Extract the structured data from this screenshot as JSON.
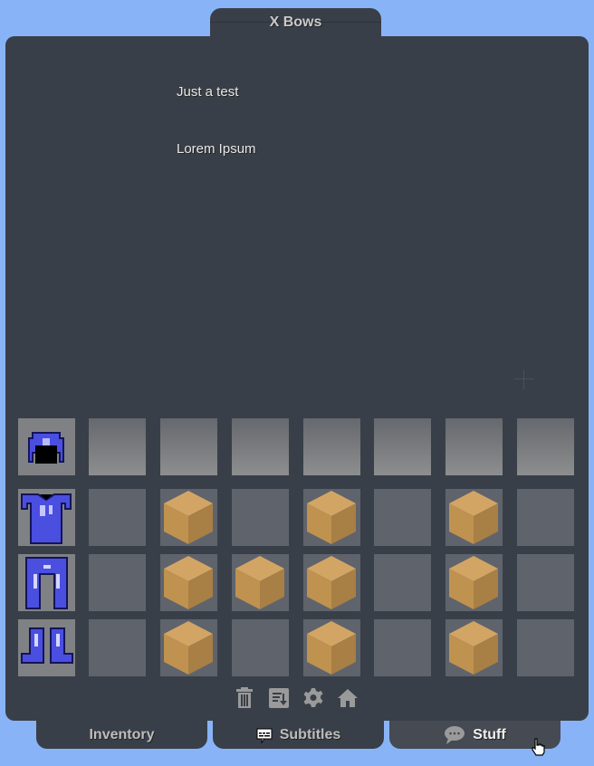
{
  "window": {
    "title": "X Bows"
  },
  "content": {
    "lines": [
      "Just a test",
      "Lorem Ipsum"
    ]
  },
  "armor_slots": [
    {
      "item": "blue-helmet"
    },
    {
      "item": "blue-chestplate"
    },
    {
      "item": "blue-leggings"
    },
    {
      "item": "blue-boots"
    }
  ],
  "hotbar_slots": [
    null,
    null,
    null,
    null,
    null,
    null,
    null
  ],
  "grid_rows": [
    [
      null,
      "sand-block",
      null,
      "sand-block",
      null,
      "sand-block",
      null
    ],
    [
      null,
      "sand-block",
      "sand-block",
      "sand-block",
      null,
      "sand-block",
      null
    ],
    [
      null,
      "sand-block",
      null,
      "sand-block",
      null,
      "sand-block",
      null
    ]
  ],
  "toolbar": [
    {
      "icon": "trash-icon",
      "label": "Trash"
    },
    {
      "icon": "sort-icon",
      "label": "Sort"
    },
    {
      "icon": "gear-icon",
      "label": "Settings"
    },
    {
      "icon": "home-icon",
      "label": "Home"
    }
  ],
  "tabs": [
    {
      "label": "Inventory",
      "icon": null,
      "active": false
    },
    {
      "label": "Subtitles",
      "icon": "subtitles-icon",
      "active": false
    },
    {
      "label": "Stuff",
      "icon": "chat-bubble-icon",
      "active": true
    }
  ],
  "colors": {
    "background": "#88b4f7",
    "panel": "#393f48",
    "slot": "#5f636c",
    "armor_blue": "#4a4fe0",
    "sand": "#c89a58"
  }
}
